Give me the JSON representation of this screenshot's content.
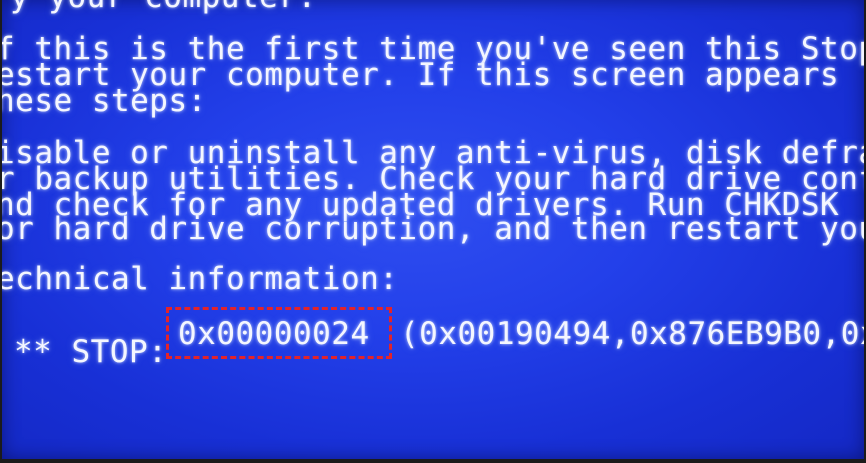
{
  "screen": {
    "background_color": "#2340ea",
    "text_color": "#f4f6ff",
    "lines": [
      "y your computer.",
      "f this is the first time you've seen this Stop",
      "estart your computer. If this screen appears",
      "hese steps:",
      "isable or uninstall any anti-virus, disk defra",
      "r backup utilities. Check your hard drive conf",
      "nd check for any updated drivers. Run CHKDSK",
      "or hard drive corruption, and then restart you",
      "echnical information:"
    ],
    "stop": {
      "prefix": "** STOP: ",
      "code": "0x00000024",
      "params": "(0x00190494,0x876EB9B0,0x",
      "highlight_color": "#e3232a"
    }
  }
}
